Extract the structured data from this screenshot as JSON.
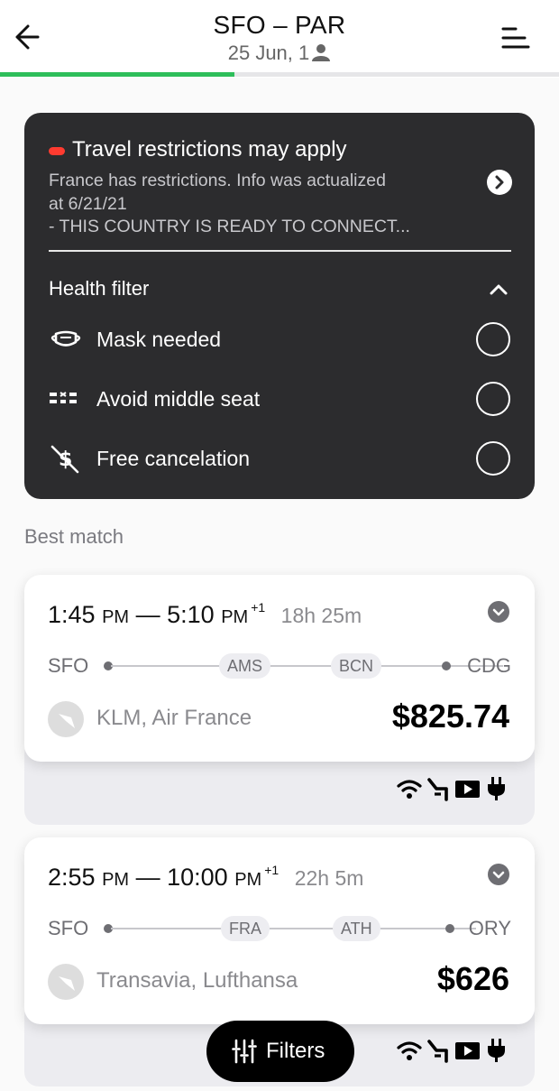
{
  "header": {
    "route": "SFO – PAR",
    "date_passengers": "25 Jun, 1",
    "progress_percent": 42
  },
  "restrictions": {
    "title": "Travel restrictions may apply",
    "body_line1": "France has restrictions. Info was actualized",
    "body_line2": "at 6/21/21",
    "body_line3": "- THIS COUNTRY IS READY TO CONNECT..."
  },
  "health_filter": {
    "title": "Health filter",
    "options": [
      {
        "label": "Mask needed",
        "icon": "mask-icon",
        "selected": false
      },
      {
        "label": "Avoid middle seat",
        "icon": "seat-icon",
        "selected": false
      },
      {
        "label": "Free cancelation",
        "icon": "no-dollar-icon",
        "selected": false
      }
    ]
  },
  "section_title": "Best match",
  "flights": [
    {
      "depart": "1:45",
      "depart_ampm": "PM",
      "dash": "—",
      "arrive": "5:10",
      "arrive_ampm": "PM",
      "day_offset": "+1",
      "duration": "18h 25m",
      "origin": "SFO",
      "stop1": "AMS",
      "stop2": "BCN",
      "destination": "CDG",
      "airlines": "KLM, Air France",
      "price": "$825.74",
      "amenities": [
        "wifi-icon",
        "seat-recline-icon",
        "video-icon",
        "power-icon"
      ]
    },
    {
      "depart": "2:55",
      "depart_ampm": "PM",
      "dash": "—",
      "arrive": "10:00",
      "arrive_ampm": "PM",
      "day_offset": "+1",
      "duration": "22h 5m",
      "origin": "SFO",
      "stop1": "FRA",
      "stop2": "ATH",
      "destination": "ORY",
      "airlines": "Transavia, Lufthansa",
      "price": "$626",
      "amenities": [
        "wifi-icon",
        "seat-recline-icon",
        "video-icon",
        "power-icon"
      ]
    }
  ],
  "filters_button": "Filters",
  "colors": {
    "progress": "#2dbe5a",
    "restriction_pill": "#ff3b30",
    "dark_card": "#2c2c2e"
  }
}
